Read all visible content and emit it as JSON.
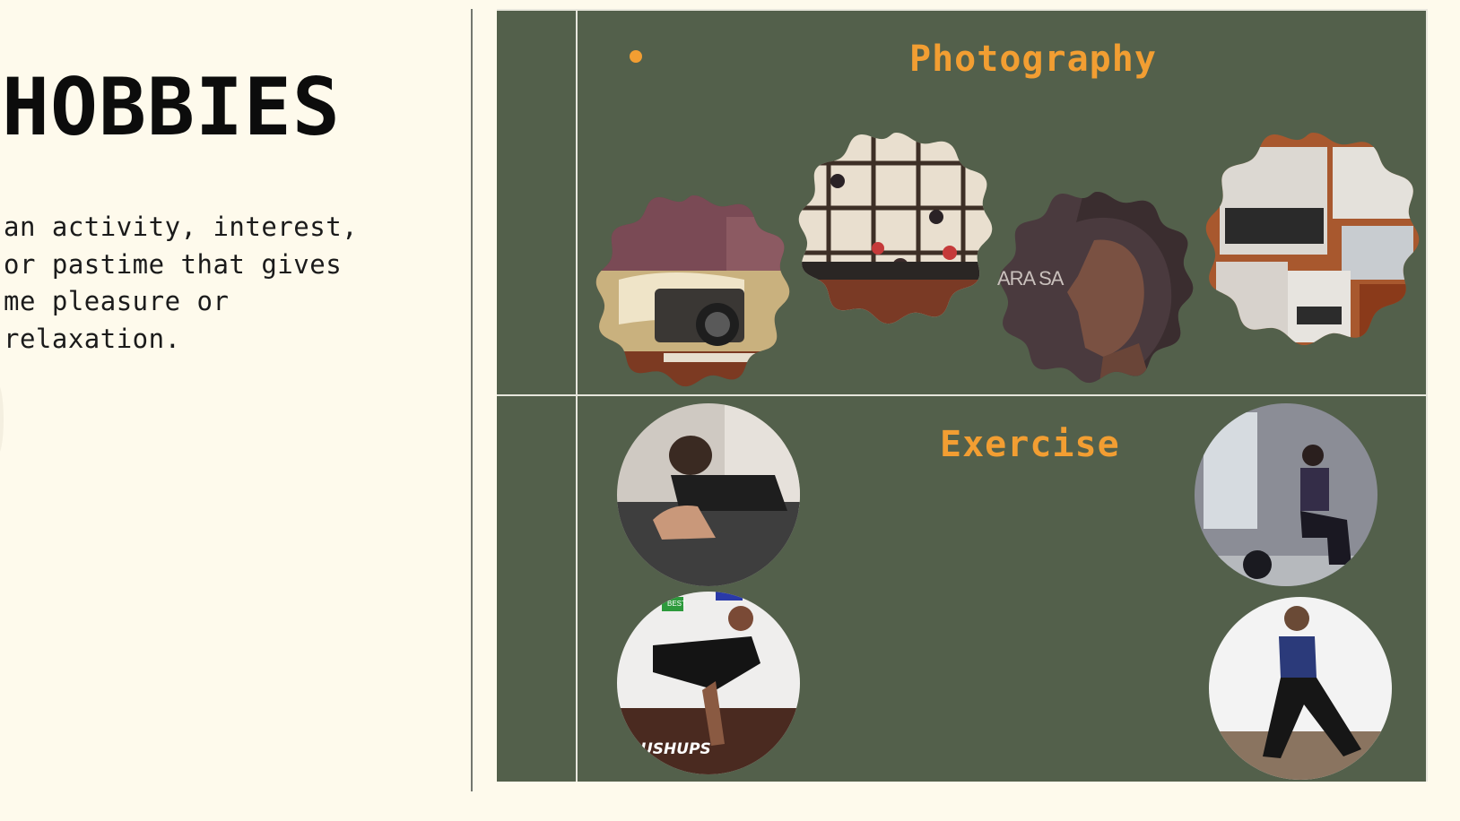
{
  "page": {
    "title": "HOBBIES",
    "definition": "an activity, interest,\nor pastime that gives\nme pleasure or\nrelaxation."
  },
  "sections": {
    "photography": {
      "title": "Photography",
      "photos": [
        {
          "icon": "camera-on-books-photo"
        },
        {
          "icon": "window-ornaments-photo"
        },
        {
          "icon": "portrait-profile-photo",
          "caption": "ARA SA"
        },
        {
          "icon": "cafe-collage-photo"
        }
      ]
    },
    "exercise": {
      "title": "Exercise",
      "photos": [
        {
          "icon": "plank-exercise-photo"
        },
        {
          "icon": "squat-exercise-photo"
        },
        {
          "icon": "pushup-exercise-photo",
          "caption": "USHUPS",
          "badge": "BEST"
        },
        {
          "icon": "lunge-exercise-photo"
        }
      ]
    }
  },
  "colors": {
    "background": "#fefaec",
    "board": "#53604b",
    "accent": "#f29e32",
    "rule": "#e6e6dc"
  }
}
